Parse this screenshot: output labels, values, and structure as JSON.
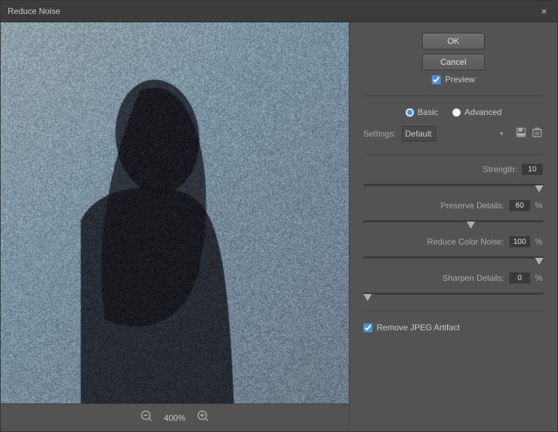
{
  "titleBar": {
    "title": "Reduce Noise",
    "closeLabel": "×"
  },
  "controls": {
    "okLabel": "OK",
    "cancelLabel": "Cancel",
    "previewLabel": "Preview",
    "previewChecked": true,
    "modeBasicLabel": "Basic",
    "modeAdvancedLabel": "Advanced",
    "settingsLabel": "Settings:",
    "settingsValue": "Default",
    "settingsOptions": [
      "Default"
    ],
    "strengthLabel": "Strength:",
    "strengthValue": "10",
    "preserveDetailsLabel": "Preserve Details:",
    "preserveDetailsValue": "60",
    "reduceColorNoiseLabel": "Reduce Color Noise:",
    "reduceColorNoiseValue": "100",
    "sharpenDetailsLabel": "Sharpen Details:",
    "sharpenDetailsValue": "0",
    "removeArtifactLabel": "Remove JPEG Artifact",
    "removeArtifactChecked": true,
    "percentSign": "%"
  },
  "footer": {
    "zoomLevel": "400%",
    "zoomInIcon": "⊕",
    "zoomOutIcon": "⊖"
  },
  "icons": {
    "savePreset": "💾",
    "deletePreset": "🗑"
  }
}
